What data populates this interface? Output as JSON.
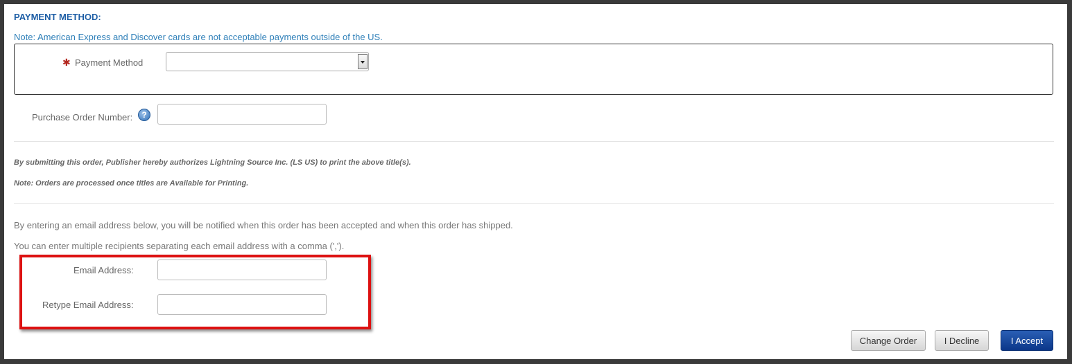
{
  "payment": {
    "title": "PAYMENT METHOD:",
    "note": "Note: American Express and Discover cards are not acceptable payments outside of the US.",
    "required_mark": "✱",
    "method_label": "Payment Method",
    "method_value": "",
    "po_label": "Purchase Order Number:",
    "po_value": "",
    "help_glyph": "?"
  },
  "authorization": {
    "line1": "By submitting this order, Publisher hereby authorizes Lightning Source Inc. (LS US) to print the above title(s).",
    "line2": "Note: Orders are processed once titles are Available for Printing."
  },
  "email": {
    "info1": "By entering an email address below, you will be notified when this order has been accepted and when this order has shipped.",
    "info2": "You can enter multiple recipients separating each email address with a comma (',').",
    "email_label": "Email Address:",
    "email_value": "",
    "retype_label": "Retype Email Address:",
    "retype_value": ""
  },
  "actions": {
    "change_label": "Change Order",
    "decline_label": "I Decline",
    "accept_label": "I Accept"
  },
  "colors": {
    "title_blue": "#1f5fa6",
    "highlight_red": "#dd1111",
    "accept_blue": "#0b3789"
  },
  "icons": {
    "help": "help-circle-icon",
    "required": "required-asterisk-icon",
    "dropdown": "chevron-down-icon"
  }
}
